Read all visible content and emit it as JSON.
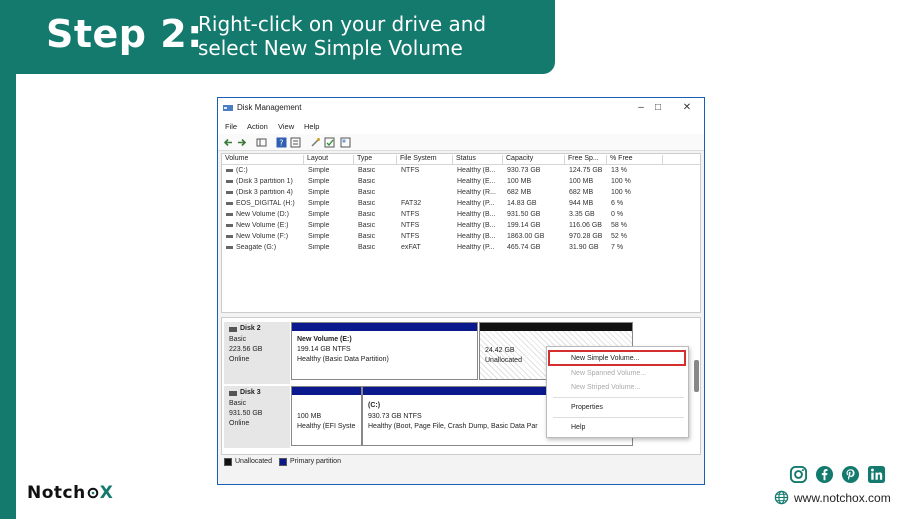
{
  "banner": {
    "step": "Step 2:",
    "description": "Right-click on your drive and select New Simple Volume"
  },
  "brand": {
    "logo_prefix": "Notch",
    "logo_suffix": "X",
    "website": "www.notchox.com"
  },
  "socials": [
    "instagram-icon",
    "facebook-icon",
    "pinterest-icon",
    "linkedin-icon"
  ],
  "window": {
    "title": "Disk Management",
    "menu": [
      "File",
      "Action",
      "View",
      "Help"
    ]
  },
  "volume_table": {
    "columns": [
      "Volume",
      "Layout",
      "Type",
      "File System",
      "Status",
      "Capacity",
      "Free Sp...",
      "% Free"
    ],
    "rows": [
      [
        "(C:)",
        "Simple",
        "Basic",
        "NTFS",
        "Healthy (B...",
        "930.73 GB",
        "124.75 GB",
        "13 %"
      ],
      [
        "(Disk 3 partition 1)",
        "Simple",
        "Basic",
        "",
        "Healthy (E...",
        "100 MB",
        "100 MB",
        "100 %"
      ],
      [
        "(Disk 3 partition 4)",
        "Simple",
        "Basic",
        "",
        "Healthy (R...",
        "682 MB",
        "682 MB",
        "100 %"
      ],
      [
        "EOS_DIGITAL (H:)",
        "Simple",
        "Basic",
        "FAT32",
        "Healthy (P...",
        "14.83 GB",
        "944 MB",
        "6 %"
      ],
      [
        "New Volume (D:)",
        "Simple",
        "Basic",
        "NTFS",
        "Healthy (B...",
        "931.50 GB",
        "3.35 GB",
        "0 %"
      ],
      [
        "New Volume (E:)",
        "Simple",
        "Basic",
        "NTFS",
        "Healthy (B...",
        "199.14 GB",
        "116.06 GB",
        "58 %"
      ],
      [
        "New Volume (F:)",
        "Simple",
        "Basic",
        "NTFS",
        "Healthy (B...",
        "1863.00 GB",
        "970.28 GB",
        "52 %"
      ],
      [
        "Seagate (G:)",
        "Simple",
        "Basic",
        "exFAT",
        "Healthy (P...",
        "465.74 GB",
        "31.90 GB",
        "7 %"
      ]
    ]
  },
  "disk2": {
    "name": "Disk 2",
    "type": "Basic",
    "size": "223.56 GB",
    "state": "Online",
    "part1_name": "New Volume  (E:)",
    "part1_size": "199.14 GB NTFS",
    "part1_status": "Healthy (Basic Data Partition)",
    "part2_size": "24.42 GB",
    "part2_status": "Unallocated"
  },
  "disk3": {
    "name": "Disk 3",
    "type": "Basic",
    "size": "931.50 GB",
    "state": "Online",
    "part1_size": "100 MB",
    "part1_status": "Healthy (EFI Syste",
    "part2_name": "(C:)",
    "part2_size": "930.73 GB NTFS",
    "part2_status": "Healthy (Boot, Page File, Crash Dump, Basic Data Par"
  },
  "legend": {
    "unallocated": "Unallocated",
    "primary": "Primary partition"
  },
  "context_menu": {
    "new_simple": "New Simple Volume...",
    "new_spanned": "New Spanned Volume...",
    "new_striped": "New Striped Volume...",
    "properties": "Properties",
    "help": "Help"
  },
  "colors": {
    "brand_teal": "#147a6e",
    "partition_blue": "#0a1a8c",
    "highlight_red": "#d32f2f"
  }
}
